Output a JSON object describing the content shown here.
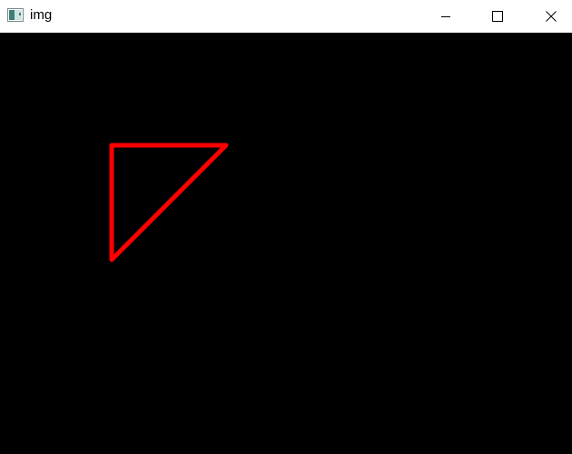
{
  "window": {
    "title": "img",
    "icon": "image-window-icon",
    "controls": {
      "minimize_icon": "minimize-icon",
      "maximize_icon": "maximize-icon",
      "close_icon": "close-icon"
    }
  },
  "canvas": {
    "background_color": "#000000",
    "shapes": [
      {
        "type": "triangle",
        "stroke_color": "#ff0000",
        "fill": "none"
      }
    ]
  }
}
